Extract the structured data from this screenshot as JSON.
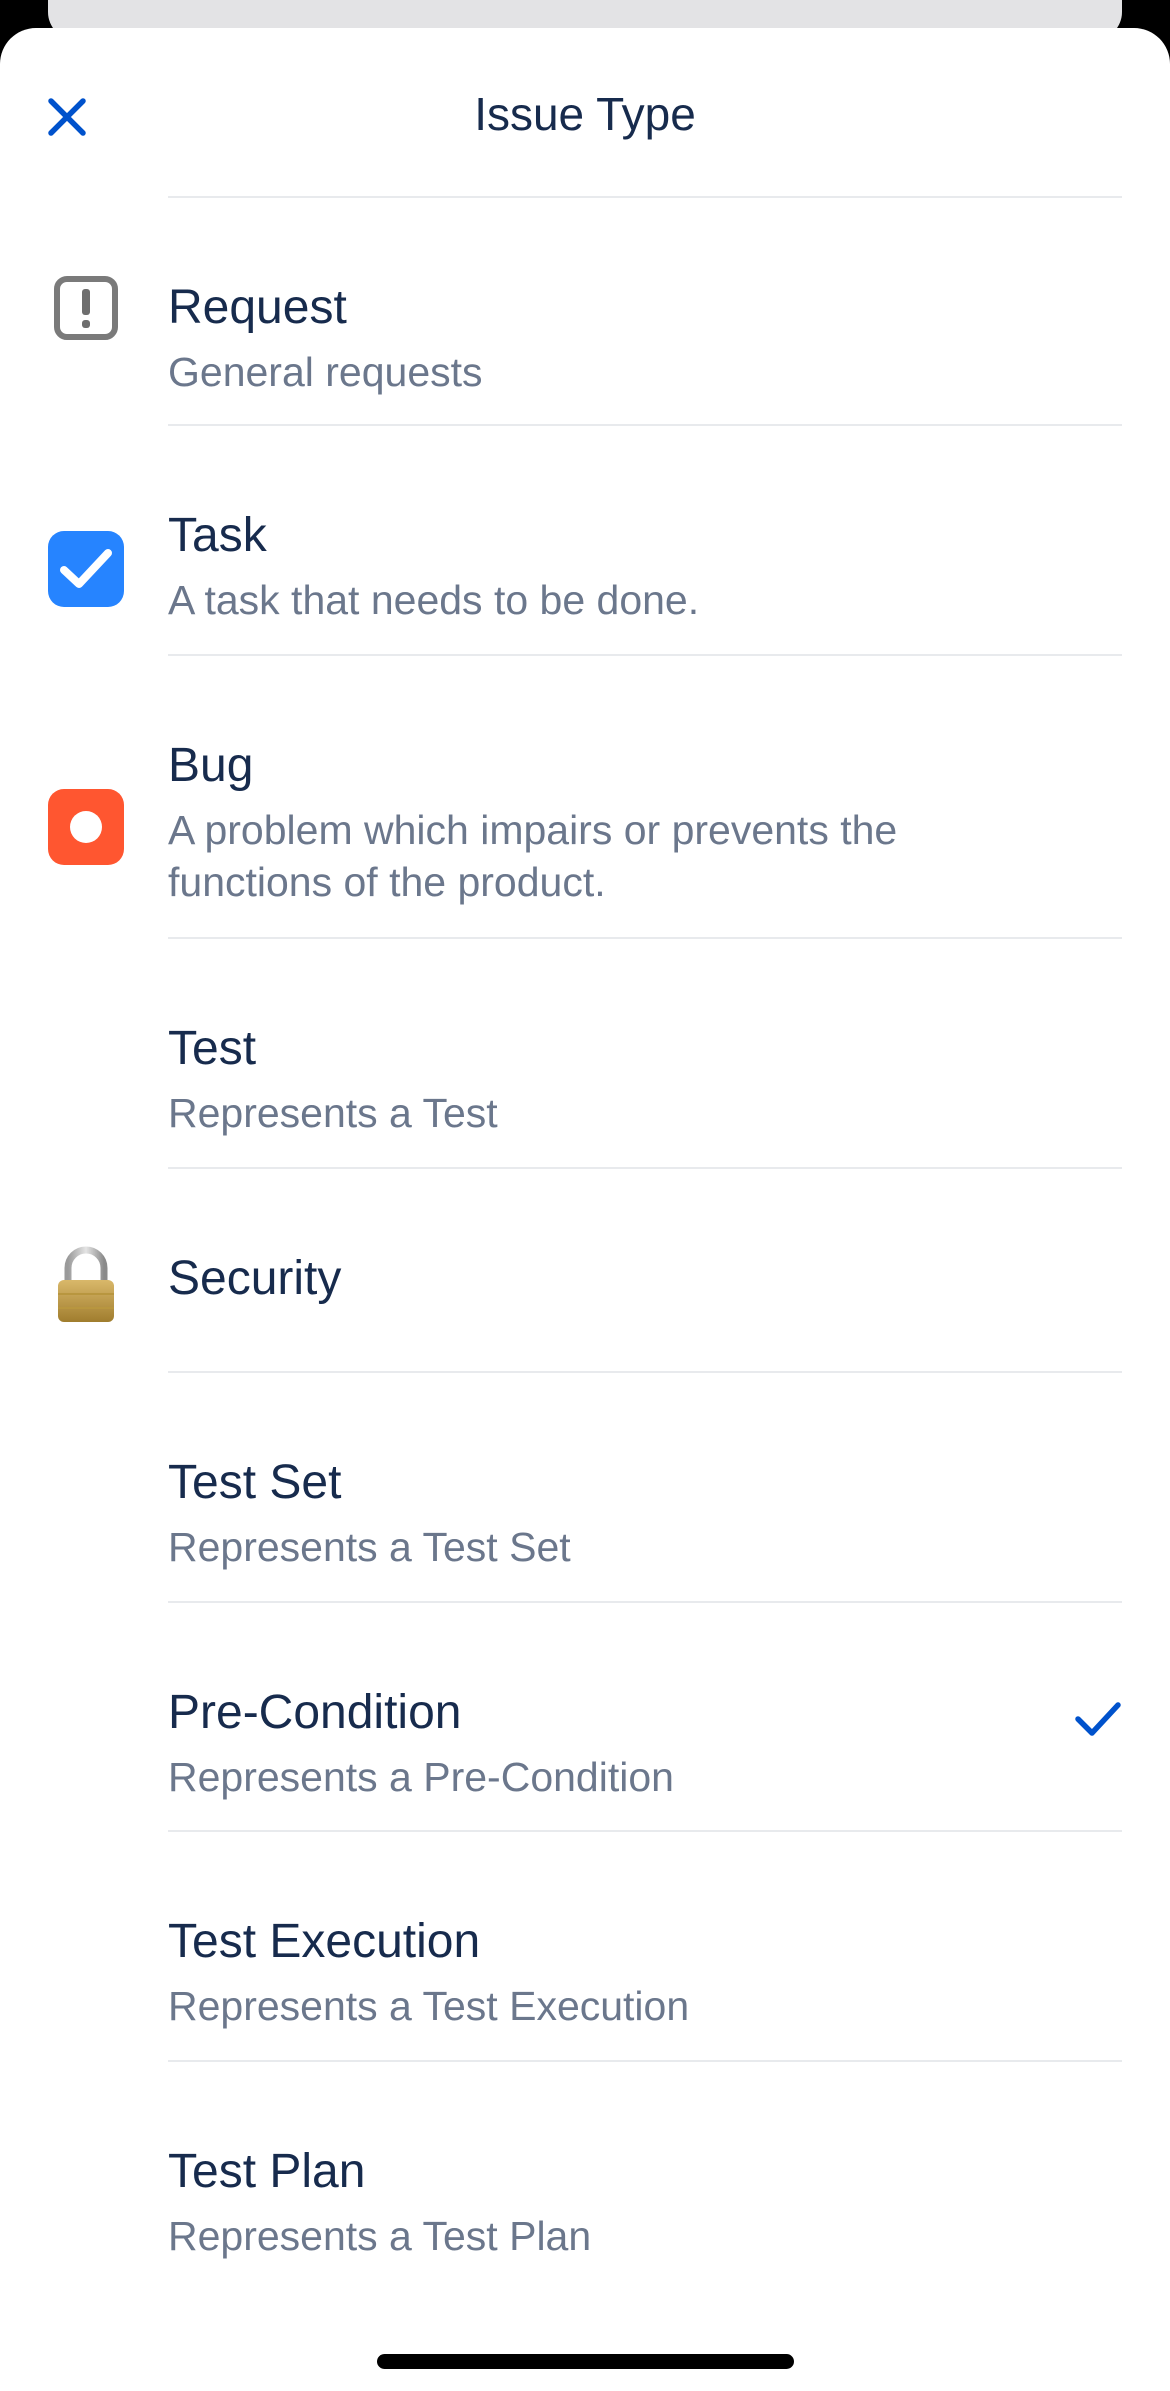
{
  "header": {
    "title": "Issue Type",
    "close_icon": "close-icon"
  },
  "colors": {
    "accent": "#0052cc",
    "title_text": "#172b4d",
    "secondary_text": "#6b778c",
    "divider": "#e8eaed",
    "task_blue": "#2684ff",
    "bug_red": "#ff5630"
  },
  "issue_types": [
    {
      "name": "Request",
      "description": "General requests",
      "icon": "request-icon",
      "selected": false
    },
    {
      "name": "Task",
      "description": "A task that needs to be done.",
      "icon": "task-checkbox-icon",
      "selected": false
    },
    {
      "name": "Bug",
      "description": "A problem which impairs or prevents the functions of the product.",
      "icon": "bug-icon",
      "selected": false
    },
    {
      "name": "Test",
      "description": "Represents a Test",
      "icon": "",
      "selected": false
    },
    {
      "name": "Security",
      "description": "",
      "icon": "padlock-icon",
      "selected": false
    },
    {
      "name": "Test Set",
      "description": "Represents a Test Set",
      "icon": "",
      "selected": false
    },
    {
      "name": "Pre-Condition",
      "description": "Represents a Pre-Condition",
      "icon": "",
      "selected": true
    },
    {
      "name": "Test Execution",
      "description": "Represents a Test Execution",
      "icon": "",
      "selected": false
    },
    {
      "name": "Test Plan",
      "description": "Represents a Test Plan",
      "icon": "",
      "selected": false
    }
  ]
}
